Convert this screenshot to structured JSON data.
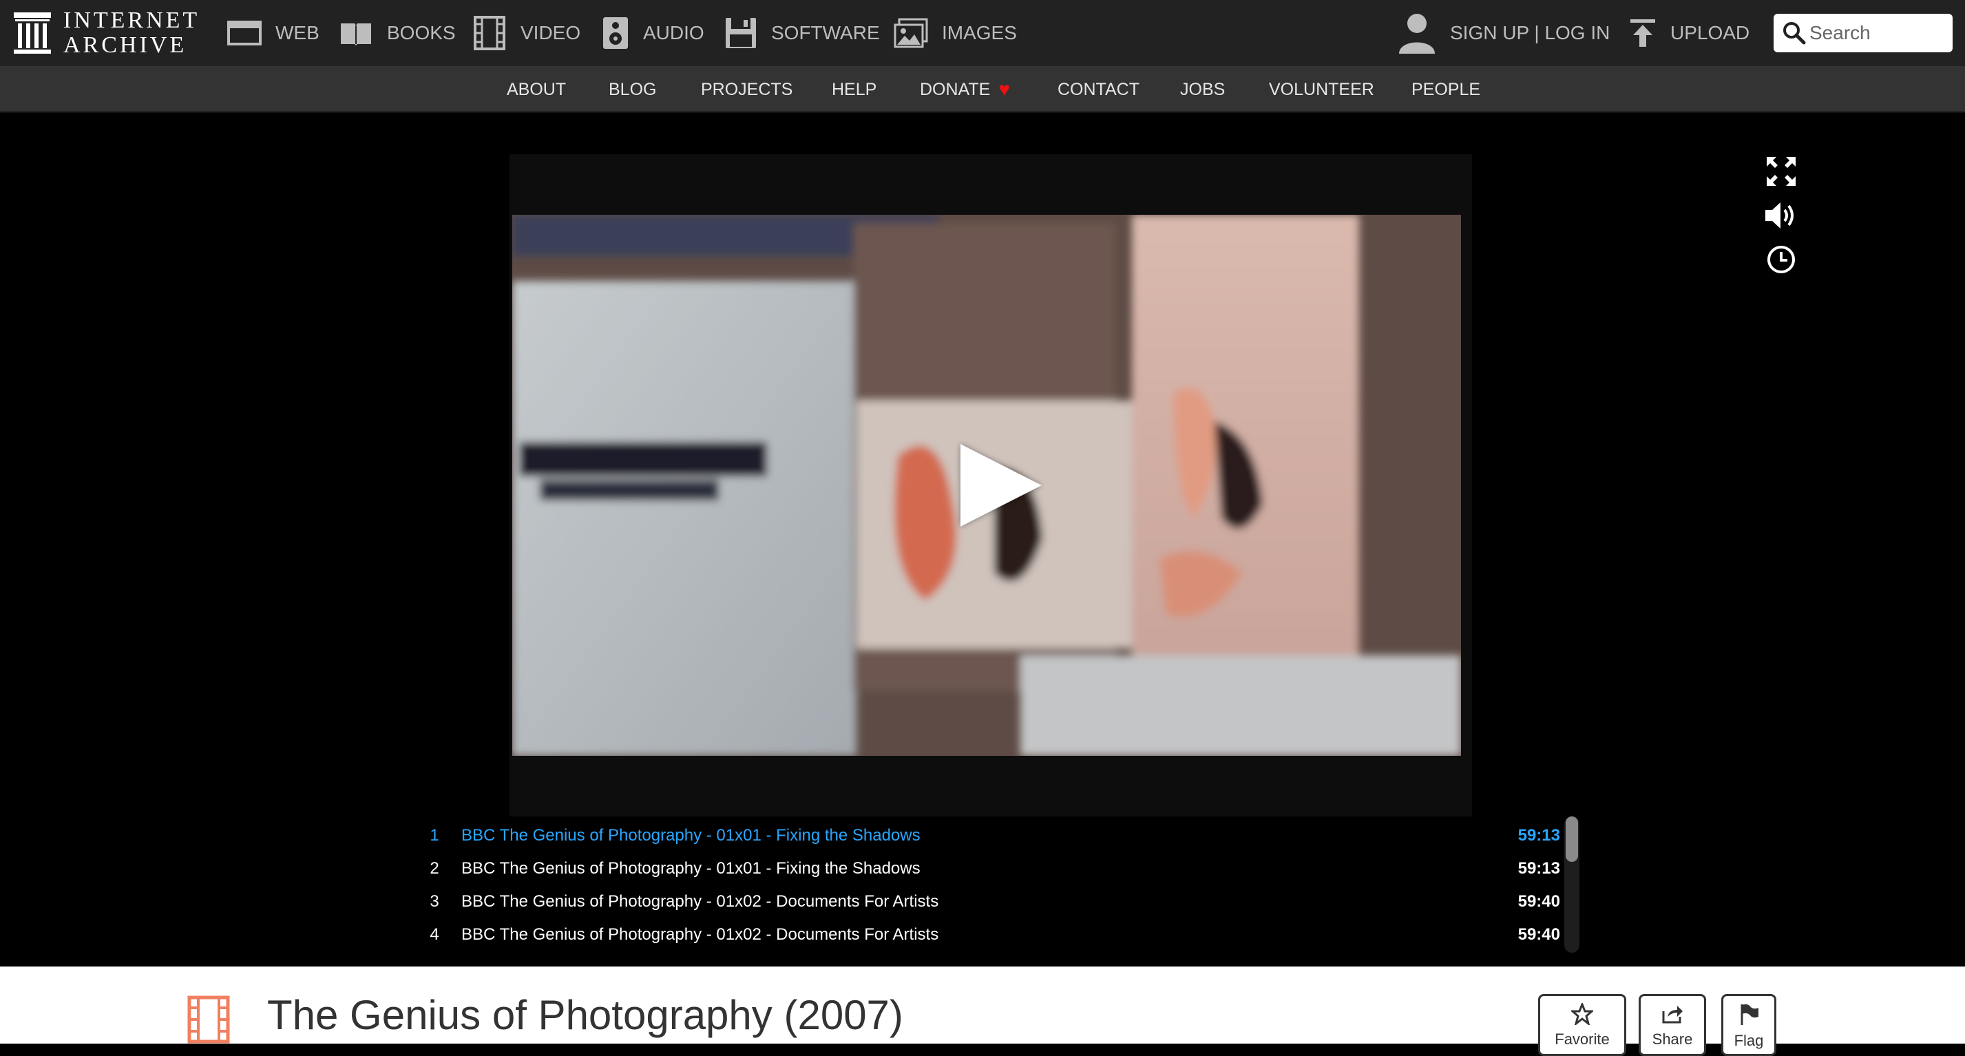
{
  "brand": {
    "line1": "INTERNET",
    "line2": "ARCHIVE"
  },
  "media_nav": [
    {
      "label": "WEB",
      "icon": "web-icon"
    },
    {
      "label": "BOOKS",
      "icon": "books-icon"
    },
    {
      "label": "VIDEO",
      "icon": "film-icon"
    },
    {
      "label": "AUDIO",
      "icon": "speaker-icon"
    },
    {
      "label": "SOFTWARE",
      "icon": "floppy-icon"
    },
    {
      "label": "IMAGES",
      "icon": "images-icon"
    }
  ],
  "account": {
    "label": "SIGN UP | LOG IN",
    "icon": "user-icon"
  },
  "upload": {
    "label": "UPLOAD",
    "icon": "upload-icon"
  },
  "search": {
    "placeholder": "Search",
    "icon": "search-icon"
  },
  "sub_nav": [
    "ABOUT",
    "BLOG",
    "PROJECTS",
    "HELP",
    "DONATE",
    "CONTACT",
    "JOBS",
    "VOLUNTEER",
    "PEOPLE"
  ],
  "sub_nav_donate_icon": "heart-icon",
  "player": {
    "controls": [
      "fullscreen-icon",
      "volume-icon",
      "clock-icon"
    ],
    "play_icon": "play-icon"
  },
  "playlist": [
    {
      "num": "1",
      "title": "BBC The Genius of Photography - 01x01 - Fixing the Shadows",
      "duration": "59:13",
      "active": true
    },
    {
      "num": "2",
      "title": "BBC The Genius of Photography - 01x01 - Fixing the Shadows",
      "duration": "59:13",
      "active": false
    },
    {
      "num": "3",
      "title": "BBC The Genius of Photography - 01x02 - Documents For Artists",
      "duration": "59:40",
      "active": false
    },
    {
      "num": "4",
      "title": "BBC The Genius of Photography - 01x02 - Documents For Artists",
      "duration": "59:40",
      "active": false
    }
  ],
  "item": {
    "title": "The Genius of Photography (2007)",
    "type_icon": "film-icon",
    "actions": [
      {
        "label": "Favorite",
        "icon": "star-icon"
      },
      {
        "label": "Share",
        "icon": "share-icon"
      },
      {
        "label": "Flag",
        "icon": "flag-icon"
      }
    ]
  },
  "colors": {
    "topbar": "#222222",
    "subbar": "#333333",
    "active_track": "#29a6ff",
    "accent_red": "#e11111",
    "film_icon": "#f08060"
  }
}
